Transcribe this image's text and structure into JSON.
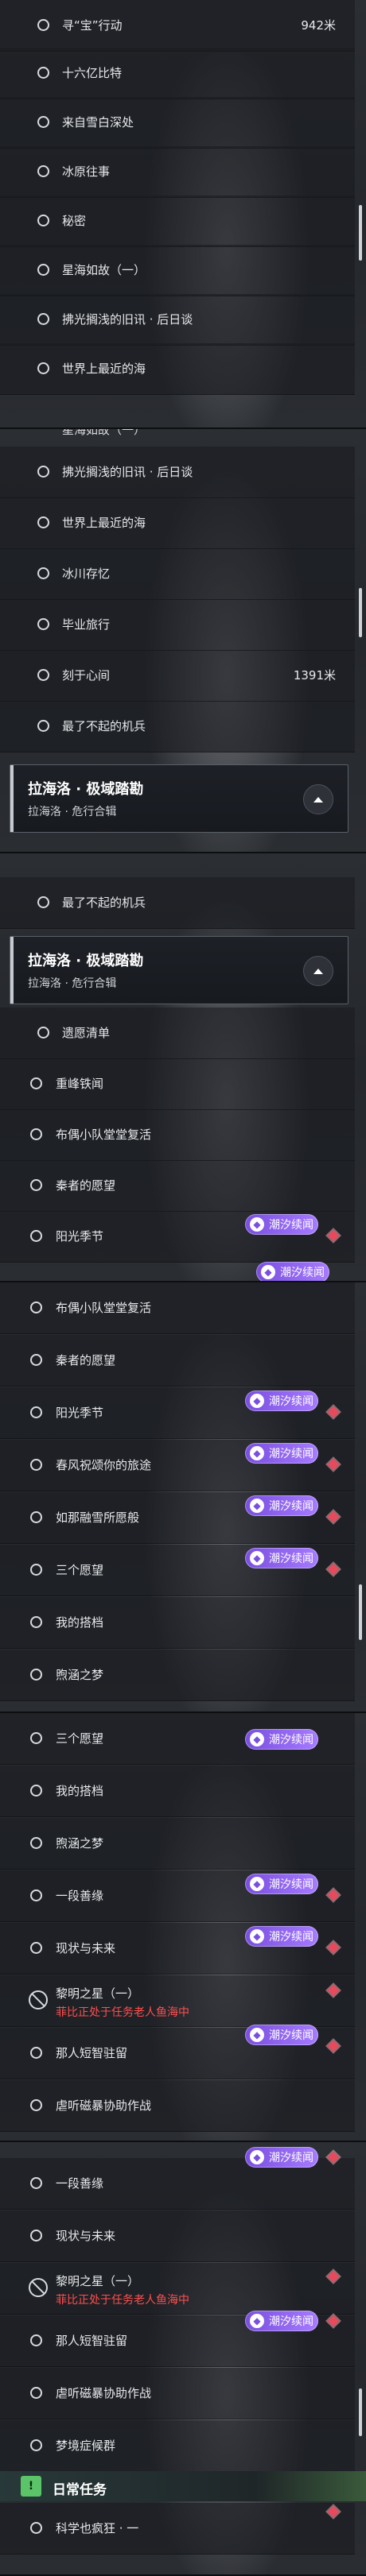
{
  "tags": {
    "chaoxi": "潮汐续闻",
    "icon": "◆"
  },
  "headers": {
    "title": "拉海洛 · 极域踏勘",
    "subtitle": "拉海洛 · 危行合辑"
  },
  "daily": {
    "label": "日常任务",
    "icon": "!"
  },
  "panel1": {
    "rows": [
      {
        "label": "寻“宝”行动",
        "distance": "942米"
      },
      {
        "label": "十六亿比特"
      },
      {
        "label": "来自雪白深处"
      },
      {
        "label": "冰原往事"
      },
      {
        "label": "秘密"
      },
      {
        "label": "星海如故（一）"
      },
      {
        "label": "拂光搁浅的旧讯 · 后日谈"
      },
      {
        "label": "世界上最近的海"
      }
    ]
  },
  "panel2": {
    "partial": "星海如故（一）",
    "rows": [
      {
        "label": "拂光搁浅的旧讯 · 后日谈"
      },
      {
        "label": "世界上最近的海"
      },
      {
        "label": "冰川存忆"
      },
      {
        "label": "毕业旅行"
      },
      {
        "label": "刻于心间",
        "distance": "1391米"
      },
      {
        "label": "最了不起的机兵"
      }
    ]
  },
  "panel3": {
    "rows_top": [
      {
        "label": "最了不起的机兵"
      }
    ],
    "rows": [
      {
        "label": "遗愿清单"
      },
      {
        "label": "重峰铁闻"
      },
      {
        "label": "布偶小队堂堂复活"
      },
      {
        "label": "秦者的愿望"
      },
      {
        "label": "阳光季节"
      }
    ]
  },
  "panel4": {
    "rows": [
      {
        "label": "布偶小队堂堂复活"
      },
      {
        "label": "秦者的愿望"
      },
      {
        "label": "阳光季节"
      },
      {
        "label": "春风祝颂你的旅途"
      },
      {
        "label": "如那融雪所愿般"
      },
      {
        "label": "三个愿望"
      },
      {
        "label": "我的搭档"
      },
      {
        "label": "煦涵之梦"
      }
    ]
  },
  "panel5": {
    "rows": [
      {
        "label": "三个愿望"
      },
      {
        "label": "我的搭档"
      },
      {
        "label": "煦涵之梦"
      },
      {
        "label": "一段善缘"
      },
      {
        "label": "现状与未来"
      },
      {
        "label": "黎明之星（一）",
        "sub": "菲比正处于任务老人鱼海中"
      },
      {
        "label": "那人短智驻留"
      },
      {
        "label": "虐听磁暴协助作战"
      }
    ]
  },
  "panel6": {
    "rows": [
      {
        "label": "一段善缘"
      },
      {
        "label": "现状与未来"
      },
      {
        "label": "黎明之星（一）",
        "sub": "菲比正处于任务老人鱼海中"
      },
      {
        "label": "那人短智驻留"
      },
      {
        "label": "虐听磁暴协助作战"
      },
      {
        "label": "梦境症候群"
      }
    ],
    "daily_row": {
      "label": "科学也疯狂 · 一"
    }
  }
}
